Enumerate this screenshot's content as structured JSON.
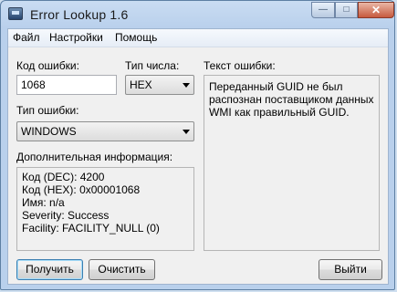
{
  "window": {
    "title": "Error Lookup 1.6",
    "min_glyph": "—",
    "max_glyph": "□",
    "close_glyph": "✕"
  },
  "menu": {
    "items": [
      "Файл",
      "Настройки",
      "Помощь"
    ]
  },
  "form": {
    "error_code_label": "Код ошибки:",
    "error_code_value": "1068",
    "number_type_label": "Тип числа:",
    "number_type_value": "HEX",
    "error_type_label": "Тип ошибки:",
    "error_type_value": "WINDOWS",
    "extra_info_label": "Дополнительная информация:",
    "extra_info_lines": [
      "Код (DEC): 4200",
      "Код (HEX): 0x00001068",
      "Имя: n/a",
      "Severity: Success",
      "Facility: FACILITY_NULL (0)"
    ],
    "error_text_label": "Текст ошибки:",
    "error_text_lines": [
      "Переданный GUID не был",
      "распознан поставщиком данных",
      "WMI как правильный GUID."
    ]
  },
  "buttons": {
    "get": "Получить",
    "clear": "Очистить",
    "exit": "Выйти"
  }
}
